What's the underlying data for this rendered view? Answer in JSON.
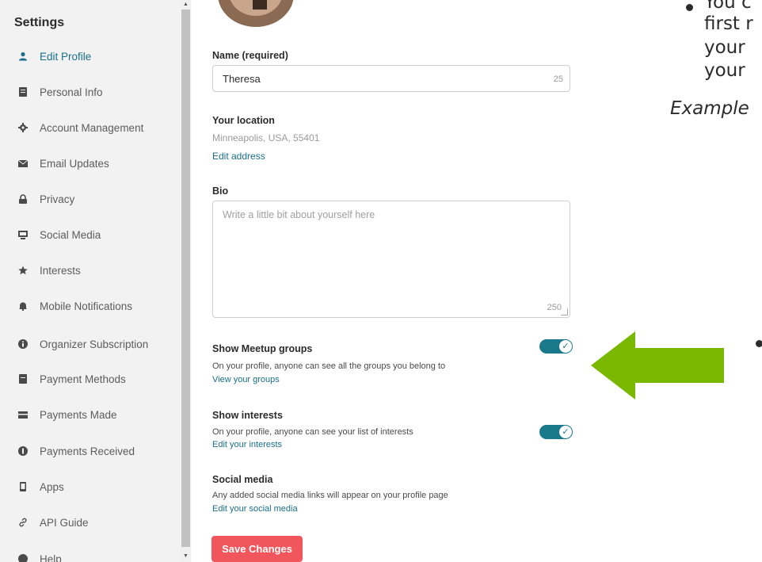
{
  "sidebar": {
    "title": "Settings",
    "items": [
      {
        "label": "Edit Profile",
        "icon": "user-icon"
      },
      {
        "label": "Personal Info",
        "icon": "document-icon"
      },
      {
        "label": "Account Management",
        "icon": "gear-icon"
      },
      {
        "label": "Email Updates",
        "icon": "envelope-icon"
      },
      {
        "label": "Privacy",
        "icon": "lock-icon"
      },
      {
        "label": "Social Media",
        "icon": "monitor-icon"
      },
      {
        "label": "Interests",
        "icon": "star-icon"
      },
      {
        "label": "Mobile Notifications",
        "icon": "bell-icon"
      },
      {
        "label": "Organizer Subscription",
        "icon": "circle-info-icon"
      },
      {
        "label": "Payment Methods",
        "icon": "card-icon"
      },
      {
        "label": "Payments Made",
        "icon": "wallet-icon"
      },
      {
        "label": "Payments Received",
        "icon": "circle-dollar-icon"
      },
      {
        "label": "Apps",
        "icon": "phone-icon"
      },
      {
        "label": "API Guide",
        "icon": "link-icon"
      },
      {
        "label": "Help",
        "icon": "help-icon"
      }
    ]
  },
  "form": {
    "name_label": "Name (required)",
    "name_value": "Theresa",
    "name_counter": "25",
    "location_label": "Your location",
    "location_value": "Minneapolis, USA, 55401",
    "edit_address": "Edit address",
    "bio_label": "Bio",
    "bio_placeholder": "Write a little bit about yourself here",
    "bio_counter": "250",
    "groups_title": "Show Meetup groups",
    "groups_desc": "On your profile, anyone can see all the groups you belong to",
    "groups_link": "View your groups",
    "groups_enabled": true,
    "interests_title": "Show interests",
    "interests_desc": "On your profile, anyone can see your list of interests",
    "interests_link": "Edit your interests",
    "interests_enabled": true,
    "social_title": "Social media",
    "social_desc": "Any added social media links will appear on your profile page",
    "social_link": "Edit your social media",
    "save_label": "Save Changes"
  },
  "overlay": {
    "line1": "You c",
    "line2": "first r",
    "line3": "your",
    "line4": "your",
    "example": "Example"
  },
  "colors": {
    "accent": "#1a7a8c",
    "link": "#1a6f8a",
    "save_button": "#f0565c",
    "arrow": "#7ab800"
  }
}
